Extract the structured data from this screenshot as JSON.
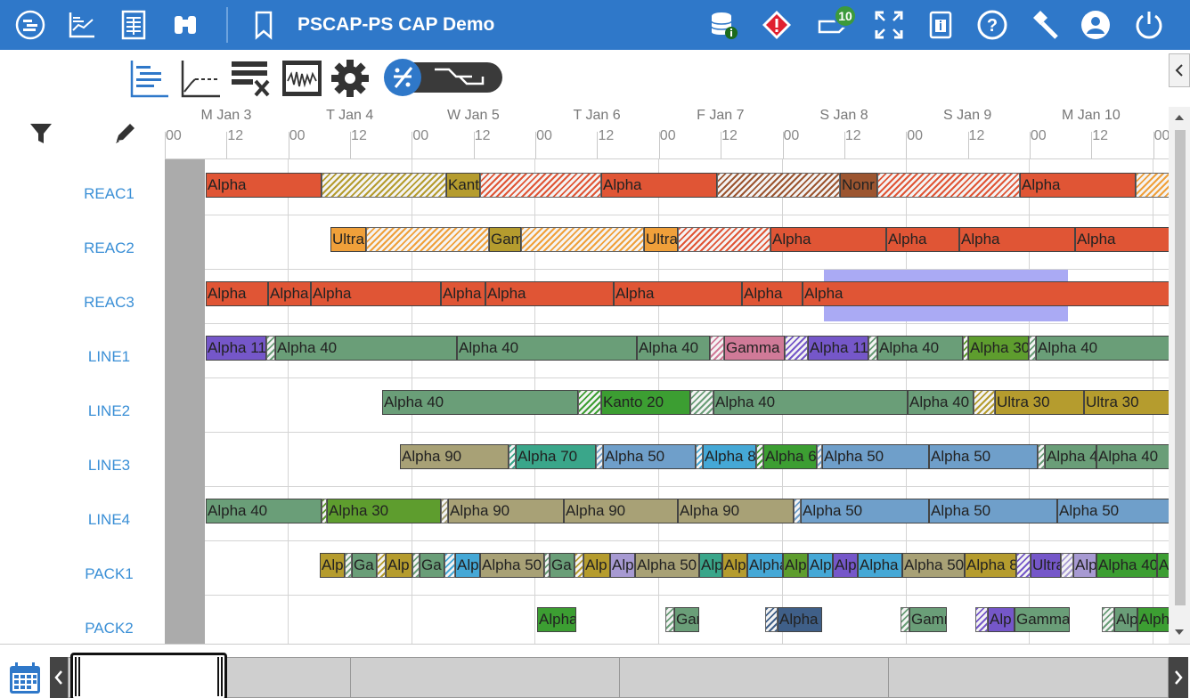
{
  "app": {
    "title": "PSCAP-PS CAP Demo",
    "notification_count": "10",
    "accent_color": "#2f78c9",
    "header_icons": [
      "gantt-icon",
      "chart-icon",
      "table-icon",
      "binoculars-icon",
      "bookmark-icon",
      "database-info-icon",
      "alert-icon",
      "message-icon",
      "fullscreen-icon",
      "document-info-icon",
      "help-icon",
      "hammer-icon",
      "user-icon",
      "power-icon"
    ]
  },
  "toolbar": {
    "icons": [
      "gantt-view-icon",
      "line-chart-icon",
      "clear-filter-icon",
      "waveform-icon",
      "settings-icon",
      "percent-toggle-icon"
    ]
  },
  "timeline": {
    "days": [
      "M Jan 3",
      "T Jan 4",
      "W Jan 5",
      "T Jan 6",
      "F Jan 7",
      "S Jan 8",
      "S Jan 9",
      "M Jan 10"
    ],
    "hours": [
      "00",
      "12",
      "00",
      "12",
      "00",
      "12",
      "00",
      "12",
      "00",
      "12",
      "00",
      "12",
      "00",
      "12",
      "00",
      "12",
      "00"
    ]
  },
  "resources": [
    "REAC1",
    "REAC2",
    "REAC3",
    "LINE1",
    "LINE2",
    "LINE3",
    "LINE4",
    "PACK1",
    "PACK2"
  ],
  "colors": {
    "red": "#e05535",
    "orange": "#f0a03a",
    "olive": "#b59c2e",
    "green": "#6a9e78",
    "darkgreen": "#3c9e32",
    "purple": "#7557c9",
    "khaki": "#a8a176",
    "teal": "#3aa68a",
    "blue": "#6f9fca",
    "sky": "#45a8d6",
    "brown": "#9c5530",
    "pink": "#d07a98",
    "lavender": "#a79ad2",
    "navy": "#3f5f88",
    "lime": "#5e9d2e",
    "highlight": "#aaaaf4"
  },
  "bars": [
    {
      "row": 0,
      "l": 46,
      "w": 130,
      "c": "red",
      "t": "Alpha"
    },
    {
      "row": 0,
      "l": 176,
      "w": 140,
      "c": "olive",
      "h": true
    },
    {
      "row": 0,
      "l": 316,
      "w": 38,
      "c": "olive",
      "t": "Kanto"
    },
    {
      "row": 0,
      "l": 354,
      "w": 136,
      "c": "red",
      "h": true
    },
    {
      "row": 0,
      "l": 490,
      "w": 130,
      "c": "red",
      "t": "Alpha"
    },
    {
      "row": 0,
      "l": 620,
      "w": 138,
      "c": "brown",
      "h": true
    },
    {
      "row": 0,
      "l": 758,
      "w": 42,
      "c": "brown",
      "t": "Nonr"
    },
    {
      "row": 0,
      "l": 800,
      "w": 160,
      "c": "red",
      "h": true
    },
    {
      "row": 0,
      "l": 960,
      "w": 130,
      "c": "red",
      "t": "Alpha"
    },
    {
      "row": 0,
      "l": 1090,
      "w": 40,
      "c": "orange",
      "h": true
    },
    {
      "row": 1,
      "l": 186,
      "w": 40,
      "c": "orange",
      "t": "Ultra"
    },
    {
      "row": 1,
      "l": 226,
      "w": 138,
      "c": "orange",
      "h": true
    },
    {
      "row": 1,
      "l": 364,
      "w": 36,
      "c": "olive",
      "t": "Gam"
    },
    {
      "row": 1,
      "l": 400,
      "w": 138,
      "c": "orange",
      "h": true
    },
    {
      "row": 1,
      "l": 538,
      "w": 38,
      "c": "orange",
      "t": "Ultra"
    },
    {
      "row": 1,
      "l": 576,
      "w": 104,
      "c": "red",
      "h": true
    },
    {
      "row": 1,
      "l": 680,
      "w": 130,
      "c": "red",
      "t": "Alpha"
    },
    {
      "row": 1,
      "l": 810,
      "w": 82,
      "c": "red",
      "t": "Alpha"
    },
    {
      "row": 1,
      "l": 892,
      "w": 130,
      "c": "red",
      "t": "Alpha"
    },
    {
      "row": 1,
      "l": 1022,
      "w": 108,
      "c": "red",
      "t": "Alpha"
    },
    {
      "row": 2,
      "l": 46,
      "w": 70,
      "c": "red",
      "t": "Alpha"
    },
    {
      "row": 2,
      "l": 116,
      "w": 48,
      "c": "red",
      "t": "Alpha"
    },
    {
      "row": 2,
      "l": 164,
      "w": 146,
      "c": "red",
      "t": "Alpha"
    },
    {
      "row": 2,
      "l": 310,
      "w": 50,
      "c": "red",
      "t": "Alpha"
    },
    {
      "row": 2,
      "l": 360,
      "w": 144,
      "c": "red",
      "t": "Alpha"
    },
    {
      "row": 2,
      "l": 504,
      "w": 144,
      "c": "red",
      "t": "Alpha"
    },
    {
      "row": 2,
      "l": 648,
      "w": 68,
      "c": "red",
      "t": "Alpha"
    },
    {
      "row": 2,
      "l": 716,
      "w": 414,
      "c": "red",
      "t": "Alpha"
    },
    {
      "row": 3,
      "l": 46,
      "w": 68,
      "c": "purple",
      "t": "Alpha 11"
    },
    {
      "row": 3,
      "l": 114,
      "w": 10,
      "c": "green",
      "h": true
    },
    {
      "row": 3,
      "l": 124,
      "w": 204,
      "c": "green",
      "t": "Alpha 40"
    },
    {
      "row": 3,
      "l": 328,
      "w": 202,
      "c": "green",
      "t": "Alpha 40"
    },
    {
      "row": 3,
      "l": 530,
      "w": 82,
      "c": "green",
      "t": "Alpha 40"
    },
    {
      "row": 3,
      "l": 612,
      "w": 16,
      "c": "pink",
      "h": true
    },
    {
      "row": 3,
      "l": 628,
      "w": 68,
      "c": "pink",
      "t": "Gamma"
    },
    {
      "row": 3,
      "l": 696,
      "w": 26,
      "c": "purple",
      "h": true
    },
    {
      "row": 3,
      "l": 722,
      "w": 68,
      "c": "purple",
      "t": "Alpha 11"
    },
    {
      "row": 3,
      "l": 790,
      "w": 10,
      "c": "green",
      "h": true
    },
    {
      "row": 3,
      "l": 800,
      "w": 96,
      "c": "green",
      "t": "Alpha 40"
    },
    {
      "row": 3,
      "l": 896,
      "w": 6,
      "c": "lime",
      "h": true
    },
    {
      "row": 3,
      "l": 902,
      "w": 68,
      "c": "lime",
      "t": "Alpha 30"
    },
    {
      "row": 3,
      "l": 970,
      "w": 8,
      "c": "green",
      "h": true
    },
    {
      "row": 3,
      "l": 978,
      "w": 152,
      "c": "green",
      "t": "Alpha 40"
    },
    {
      "row": 4,
      "l": 244,
      "w": 220,
      "c": "green",
      "t": "Alpha 40"
    },
    {
      "row": 4,
      "l": 464,
      "w": 26,
      "c": "darkgreen",
      "h": true
    },
    {
      "row": 4,
      "l": 490,
      "w": 100,
      "c": "darkgreen",
      "t": "Kanto 20"
    },
    {
      "row": 4,
      "l": 590,
      "w": 26,
      "c": "green",
      "h": true
    },
    {
      "row": 4,
      "l": 616,
      "w": 218,
      "c": "green",
      "t": "Alpha 40"
    },
    {
      "row": 4,
      "l": 834,
      "w": 74,
      "c": "green",
      "t": "Alpha 40"
    },
    {
      "row": 4,
      "l": 908,
      "w": 24,
      "c": "olive",
      "h": true
    },
    {
      "row": 4,
      "l": 932,
      "w": 100,
      "c": "olive",
      "t": "Ultra 30"
    },
    {
      "row": 4,
      "l": 1032,
      "w": 98,
      "c": "olive",
      "t": "Ultra 30"
    },
    {
      "row": 5,
      "l": 264,
      "w": 122,
      "c": "khaki",
      "t": "Alpha 90"
    },
    {
      "row": 5,
      "l": 386,
      "w": 8,
      "c": "teal",
      "h": true
    },
    {
      "row": 5,
      "l": 394,
      "w": 90,
      "c": "teal",
      "t": "Alpha 70"
    },
    {
      "row": 5,
      "l": 484,
      "w": 8,
      "c": "blue",
      "h": true
    },
    {
      "row": 5,
      "l": 492,
      "w": 104,
      "c": "blue",
      "t": "Alpha 50"
    },
    {
      "row": 5,
      "l": 596,
      "w": 8,
      "c": "sky",
      "h": true
    },
    {
      "row": 5,
      "l": 604,
      "w": 60,
      "c": "sky",
      "t": "Alpha 8"
    },
    {
      "row": 5,
      "l": 664,
      "w": 8,
      "c": "darkgreen",
      "h": true
    },
    {
      "row": 5,
      "l": 672,
      "w": 60,
      "c": "darkgreen",
      "t": "Alpha 6"
    },
    {
      "row": 5,
      "l": 732,
      "w": 6,
      "c": "blue",
      "h": true
    },
    {
      "row": 5,
      "l": 738,
      "w": 120,
      "c": "blue",
      "t": "Alpha 50"
    },
    {
      "row": 5,
      "l": 858,
      "w": 122,
      "c": "blue",
      "t": "Alpha 50"
    },
    {
      "row": 5,
      "l": 980,
      "w": 8,
      "c": "green",
      "h": true
    },
    {
      "row": 5,
      "l": 988,
      "w": 58,
      "c": "green",
      "t": "Alpha 4"
    },
    {
      "row": 5,
      "l": 1046,
      "w": 84,
      "c": "green",
      "t": "Alpha 40"
    },
    {
      "row": 6,
      "l": 46,
      "w": 130,
      "c": "green",
      "t": "Alpha 40"
    },
    {
      "row": 6,
      "l": 176,
      "w": 6,
      "c": "lime",
      "h": true
    },
    {
      "row": 6,
      "l": 182,
      "w": 128,
      "c": "lime",
      "t": "Alpha 30"
    },
    {
      "row": 6,
      "l": 310,
      "w": 8,
      "c": "khaki",
      "h": true
    },
    {
      "row": 6,
      "l": 318,
      "w": 130,
      "c": "khaki",
      "t": "Alpha 90"
    },
    {
      "row": 6,
      "l": 448,
      "w": 128,
      "c": "khaki",
      "t": "Alpha 90"
    },
    {
      "row": 6,
      "l": 576,
      "w": 130,
      "c": "khaki",
      "t": "Alpha 90"
    },
    {
      "row": 6,
      "l": 706,
      "w": 8,
      "c": "blue",
      "h": true
    },
    {
      "row": 6,
      "l": 714,
      "w": 144,
      "c": "blue",
      "t": "Alpha 50"
    },
    {
      "row": 6,
      "l": 858,
      "w": 144,
      "c": "blue",
      "t": "Alpha 50"
    },
    {
      "row": 6,
      "l": 1002,
      "w": 128,
      "c": "blue",
      "t": "Alpha 50"
    },
    {
      "row": 7,
      "l": 174,
      "w": 28,
      "c": "olive",
      "t": "Alp"
    },
    {
      "row": 7,
      "l": 202,
      "w": 8,
      "c": "green",
      "h": true
    },
    {
      "row": 7,
      "l": 210,
      "w": 28,
      "c": "green",
      "t": "Ga"
    },
    {
      "row": 7,
      "l": 238,
      "w": 10,
      "c": "olive",
      "h": true
    },
    {
      "row": 7,
      "l": 248,
      "w": 30,
      "c": "olive",
      "t": "Alp"
    },
    {
      "row": 7,
      "l": 278,
      "w": 8,
      "c": "green",
      "h": true
    },
    {
      "row": 7,
      "l": 286,
      "w": 28,
      "c": "green",
      "t": "Ga"
    },
    {
      "row": 7,
      "l": 314,
      "w": 12,
      "c": "sky",
      "h": true
    },
    {
      "row": 7,
      "l": 326,
      "w": 28,
      "c": "sky",
      "t": "Alp"
    },
    {
      "row": 7,
      "l": 354,
      "w": 72,
      "c": "khaki",
      "t": "Alpha 50"
    },
    {
      "row": 7,
      "l": 426,
      "w": 6,
      "c": "green",
      "h": true
    },
    {
      "row": 7,
      "l": 432,
      "w": 28,
      "c": "green",
      "t": "Ga"
    },
    {
      "row": 7,
      "l": 460,
      "w": 10,
      "c": "olive",
      "h": true
    },
    {
      "row": 7,
      "l": 470,
      "w": 30,
      "c": "olive",
      "t": "Alp"
    },
    {
      "row": 7,
      "l": 500,
      "w": 28,
      "c": "lavender",
      "t": "Alp"
    },
    {
      "row": 7,
      "l": 528,
      "w": 72,
      "c": "khaki",
      "t": "Alpha 50"
    },
    {
      "row": 7,
      "l": 600,
      "w": 26,
      "c": "teal",
      "t": "Alp"
    },
    {
      "row": 7,
      "l": 626,
      "w": 28,
      "c": "olive",
      "t": "Alp"
    },
    {
      "row": 7,
      "l": 654,
      "w": 40,
      "c": "sky",
      "t": "Alpha"
    },
    {
      "row": 7,
      "l": 694,
      "w": 28,
      "c": "lime",
      "t": "Alp"
    },
    {
      "row": 7,
      "l": 722,
      "w": 28,
      "c": "sky",
      "t": "Alp"
    },
    {
      "row": 7,
      "l": 750,
      "w": 28,
      "c": "purple",
      "t": "Alp"
    },
    {
      "row": 7,
      "l": 778,
      "w": 50,
      "c": "sky",
      "t": "Alpha"
    },
    {
      "row": 7,
      "l": 828,
      "w": 70,
      "c": "khaki",
      "t": "Alpha 50"
    },
    {
      "row": 7,
      "l": 898,
      "w": 58,
      "c": "olive",
      "t": "Alpha 8"
    },
    {
      "row": 7,
      "l": 956,
      "w": 16,
      "c": "purple",
      "h": true
    },
    {
      "row": 7,
      "l": 972,
      "w": 34,
      "c": "purple",
      "t": "Ultra"
    },
    {
      "row": 7,
      "l": 1006,
      "w": 14,
      "c": "lavender",
      "h": true
    },
    {
      "row": 7,
      "l": 1020,
      "w": 26,
      "c": "lavender",
      "t": "Alp"
    },
    {
      "row": 7,
      "l": 1046,
      "w": 68,
      "c": "darkgreen",
      "t": "Alpha 40"
    },
    {
      "row": 7,
      "l": 1114,
      "w": 16,
      "c": "darkgreen",
      "t": "A"
    },
    {
      "row": 8,
      "l": 418,
      "w": 44,
      "c": "darkgreen",
      "t": "Alpha"
    },
    {
      "row": 8,
      "l": 562,
      "w": 10,
      "c": "green",
      "h": true
    },
    {
      "row": 8,
      "l": 572,
      "w": 28,
      "c": "green",
      "t": "Gar"
    },
    {
      "row": 8,
      "l": 674,
      "w": 14,
      "c": "navy",
      "h": true
    },
    {
      "row": 8,
      "l": 688,
      "w": 50,
      "c": "navy",
      "t": "Alpha"
    },
    {
      "row": 8,
      "l": 826,
      "w": 10,
      "c": "green",
      "h": true
    },
    {
      "row": 8,
      "l": 836,
      "w": 42,
      "c": "green",
      "t": "Gamr"
    },
    {
      "row": 8,
      "l": 910,
      "w": 14,
      "c": "purple",
      "h": true
    },
    {
      "row": 8,
      "l": 924,
      "w": 30,
      "c": "purple",
      "t": "Alp"
    },
    {
      "row": 8,
      "l": 954,
      "w": 62,
      "c": "green",
      "t": "Gamma"
    },
    {
      "row": 8,
      "l": 1052,
      "w": 14,
      "c": "green",
      "h": true
    },
    {
      "row": 8,
      "l": 1066,
      "w": 26,
      "c": "green",
      "t": "Alp"
    },
    {
      "row": 8,
      "l": 1092,
      "w": 38,
      "c": "darkgreen",
      "t": "Alph"
    }
  ]
}
